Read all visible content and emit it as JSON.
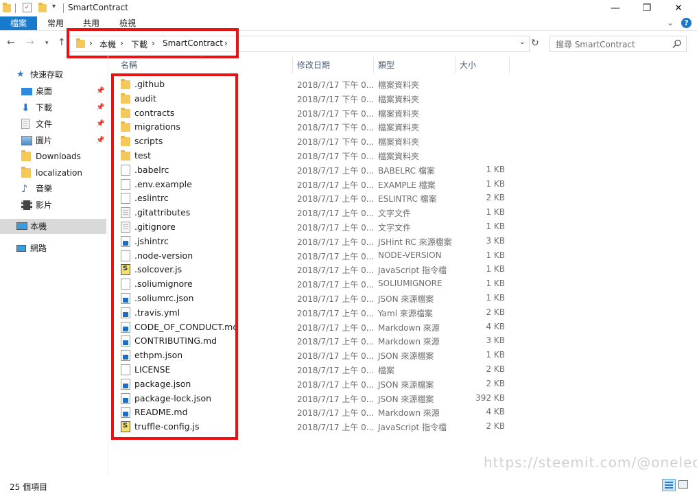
{
  "window": {
    "title": "SmartContract",
    "minimize_icon": "—",
    "maximize_icon": "❐",
    "close_icon": "✕",
    "help_icon": "?"
  },
  "ribbon": {
    "tabs": [
      "檔案",
      "常用",
      "共用",
      "檢視"
    ]
  },
  "breadcrumb": {
    "items": [
      "本機",
      "下載",
      "SmartContract"
    ]
  },
  "search": {
    "placeholder": "搜尋 SmartContract"
  },
  "sidebar": {
    "items": [
      {
        "label": "快速存取",
        "icon": "star-icon"
      },
      {
        "label": "桌面",
        "icon": "desktop-icon",
        "pinned": true
      },
      {
        "label": "下載",
        "icon": "download-icon",
        "pinned": true
      },
      {
        "label": "文件",
        "icon": "document-icon",
        "pinned": true
      },
      {
        "label": "圖片",
        "icon": "picture-icon",
        "pinned": true
      },
      {
        "label": "Downloads",
        "icon": "folder-icon"
      },
      {
        "label": "localization",
        "icon": "folder-icon"
      },
      {
        "label": "音樂",
        "icon": "music-icon"
      },
      {
        "label": "影片",
        "icon": "video-icon"
      },
      {
        "label": "本機",
        "icon": "computer-icon",
        "selected": true
      },
      {
        "label": "網路",
        "icon": "network-icon"
      }
    ]
  },
  "columns": [
    "名稱",
    "修改日期",
    "類型",
    "大小"
  ],
  "files": [
    {
      "name": ".github",
      "date": "2018/7/17 下午 0...",
      "type": "檔案資料夾",
      "size": "",
      "icon": "folder"
    },
    {
      "name": "audit",
      "date": "2018/7/17 下午 0...",
      "type": "檔案資料夾",
      "size": "",
      "icon": "folder"
    },
    {
      "name": "contracts",
      "date": "2018/7/17 下午 0...",
      "type": "檔案資料夾",
      "size": "",
      "icon": "folder"
    },
    {
      "name": "migrations",
      "date": "2018/7/17 下午 0...",
      "type": "檔案資料夾",
      "size": "",
      "icon": "folder"
    },
    {
      "name": "scripts",
      "date": "2018/7/17 下午 0...",
      "type": "檔案資料夾",
      "size": "",
      "icon": "folder"
    },
    {
      "name": "test",
      "date": "2018/7/17 下午 0...",
      "type": "檔案資料夾",
      "size": "",
      "icon": "folder"
    },
    {
      "name": ".babelrc",
      "date": "2018/7/17 上午 0...",
      "type": "BABELRC 檔案",
      "size": "1 KB",
      "icon": "file"
    },
    {
      "name": ".env.example",
      "date": "2018/7/17 上午 0...",
      "type": "EXAMPLE 檔案",
      "size": "1 KB",
      "icon": "file"
    },
    {
      "name": ".eslintrc",
      "date": "2018/7/17 上午 0...",
      "type": "ESLINTRC 檔案",
      "size": "2 KB",
      "icon": "file"
    },
    {
      "name": ".gitattributes",
      "date": "2018/7/17 上午 0...",
      "type": "文字文件",
      "size": "1 KB",
      "icon": "text"
    },
    {
      "name": ".gitignore",
      "date": "2018/7/17 上午 0...",
      "type": "文字文件",
      "size": "1 KB",
      "icon": "text"
    },
    {
      "name": ".jshintrc",
      "date": "2018/7/17 上午 0...",
      "type": "JSHint RC 來源檔案",
      "size": "3 KB",
      "icon": "vs"
    },
    {
      "name": ".node-version",
      "date": "2018/7/17 上午 0...",
      "type": "NODE-VERSION",
      "size": "1 KB",
      "icon": "file"
    },
    {
      "name": ".solcover.js",
      "date": "2018/7/17 上午 0...",
      "type": "JavaScript 指令檔",
      "size": "1 KB",
      "icon": "js"
    },
    {
      "name": ".soliumignore",
      "date": "2018/7/17 上午 0...",
      "type": "SOLIUMIGNORE",
      "size": "1 KB",
      "icon": "file"
    },
    {
      "name": ".soliumrc.json",
      "date": "2018/7/17 上午 0...",
      "type": "JSON 來源檔案",
      "size": "1 KB",
      "icon": "vs"
    },
    {
      "name": ".travis.yml",
      "date": "2018/7/17 上午 0...",
      "type": "Yaml 來源檔案",
      "size": "2 KB",
      "icon": "vs"
    },
    {
      "name": "CODE_OF_CONDUCT.md",
      "date": "2018/7/17 上午 0...",
      "type": "Markdown 來源",
      "size": "4 KB",
      "icon": "vs"
    },
    {
      "name": "CONTRIBUTING.md",
      "date": "2018/7/17 上午 0...",
      "type": "Markdown 來源",
      "size": "3 KB",
      "icon": "vs"
    },
    {
      "name": "ethpm.json",
      "date": "2018/7/17 上午 0...",
      "type": "JSON 來源檔案",
      "size": "1 KB",
      "icon": "vs"
    },
    {
      "name": "LICENSE",
      "date": "2018/7/17 上午 0...",
      "type": "檔案",
      "size": "2 KB",
      "icon": "file"
    },
    {
      "name": "package.json",
      "date": "2018/7/17 上午 0...",
      "type": "JSON 來源檔案",
      "size": "2 KB",
      "icon": "vs"
    },
    {
      "name": "package-lock.json",
      "date": "2018/7/17 上午 0...",
      "type": "JSON 來源檔案",
      "size": "392 KB",
      "icon": "vs"
    },
    {
      "name": "README.md",
      "date": "2018/7/17 上午 0...",
      "type": "Markdown 來源",
      "size": "4 KB",
      "icon": "vs"
    },
    {
      "name": "truffle-config.js",
      "date": "2018/7/17 上午 0...",
      "type": "JavaScript 指令檔",
      "size": "2 KB",
      "icon": "js"
    }
  ],
  "status": {
    "count": "25 個項目"
  },
  "watermark": "https://steemit.com/@oneleo",
  "colors": {
    "accent": "#1979ca",
    "highlight": "#ee1010",
    "folder": "#f4c95a"
  }
}
